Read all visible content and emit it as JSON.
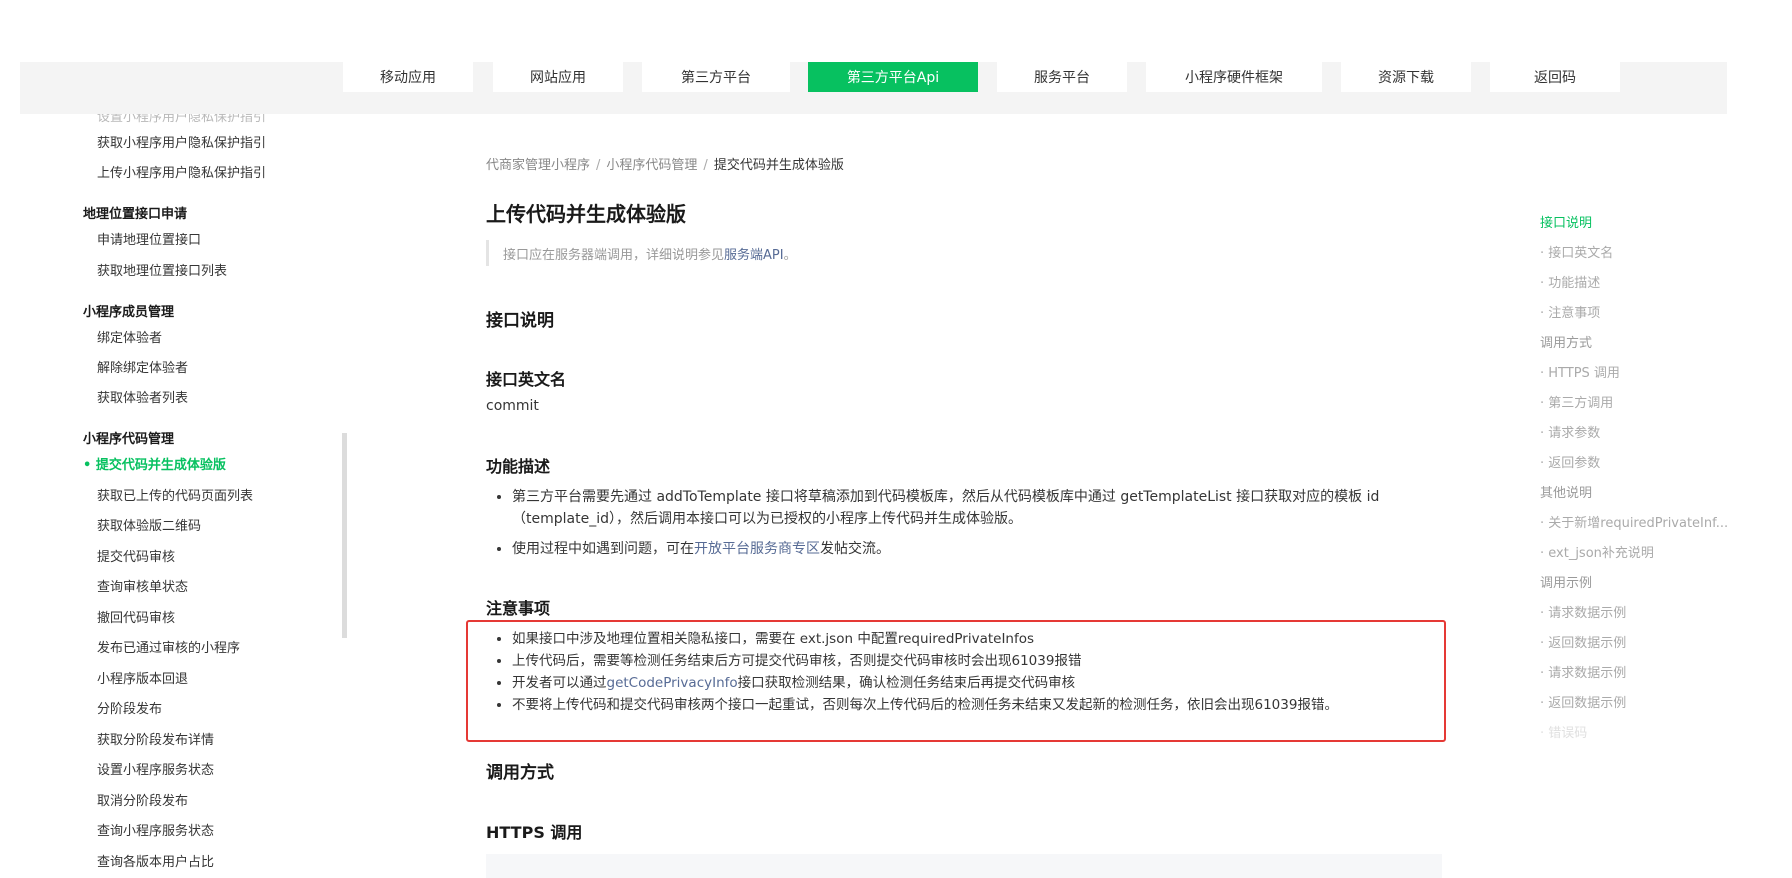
{
  "nav": {
    "tabs": [
      {
        "label": "移动应用"
      },
      {
        "label": "网站应用"
      },
      {
        "label": "第三方平台"
      },
      {
        "label": "第三方平台Api"
      },
      {
        "label": "服务平台"
      },
      {
        "label": "小程序硬件框架"
      },
      {
        "label": "资源下载"
      },
      {
        "label": "返回码"
      }
    ],
    "active_index": 3
  },
  "sidebar": {
    "clipped_top": "设置小程序用户隐私保护指引",
    "items": [
      {
        "label": "获取小程序用户隐私保护指引"
      },
      {
        "label": "上传小程序用户隐私保护指引"
      },
      {
        "group": "地理位置接口申请"
      },
      {
        "label": "申请地理位置接口"
      },
      {
        "label": "获取地理位置接口列表"
      },
      {
        "group": "小程序成员管理"
      },
      {
        "label": "绑定体验者"
      },
      {
        "label": "解除绑定体验者"
      },
      {
        "label": "获取体验者列表"
      },
      {
        "group": "小程序代码管理"
      },
      {
        "label": "提交代码并生成体验版",
        "active": true
      },
      {
        "label": "获取已上传的代码页面列表"
      },
      {
        "label": "获取体验版二维码"
      },
      {
        "label": "提交代码审核"
      },
      {
        "label": "查询审核单状态"
      },
      {
        "label": "撤回代码审核"
      },
      {
        "label": "发布已通过审核的小程序"
      },
      {
        "label": "小程序版本回退"
      },
      {
        "label": "分阶段发布"
      },
      {
        "label": "获取分阶段发布详情"
      },
      {
        "label": "设置小程序服务状态"
      },
      {
        "label": "取消分阶段发布"
      },
      {
        "label": "查询小程序服务状态"
      },
      {
        "label": "查询各版本用户占比"
      }
    ]
  },
  "breadcrumb": {
    "items": [
      "代商家管理小程序",
      "小程序代码管理",
      "提交代码并生成体验版"
    ],
    "separator": "/"
  },
  "page": {
    "title": "上传代码并生成体验版",
    "notice_prefix": "接口应在服务器端调用，详细说明参见",
    "notice_link": "服务端API",
    "notice_suffix": "。"
  },
  "content": {
    "section_interface": "接口说明",
    "english_name_heading": "接口英文名",
    "english_name": "commit",
    "func_heading": "功能描述",
    "func_item1": "第三方平台需要先通过 addToTemplate 接口将草稿添加到代码模板库，然后从代码模板库中通过 getTemplateList 接口获取对应的模板 id（template_id），然后调用本接口可以为已授权的小程序上传代码并生成体验版。",
    "func_item2_prefix": "使用过程中如遇到问题，可在",
    "func_item2_link": "开放平台服务商专区",
    "func_item2_suffix": "发帖交流。",
    "notes_heading": "注意事项",
    "note1": "如果接口中涉及地理位置相关隐私接口，需要在 ext.json 中配置requiredPrivateInfos",
    "note2": "上传代码后，需要等检测任务结束后方可提交代码审核，否则提交代码审核时会出现61039报错",
    "note3_prefix": "开发者可以通过",
    "note3_link": "getCodePrivacyInfo",
    "note3_suffix": "接口获取检测结果，确认检测任务结束后再提交代码审核",
    "note4": "不要将上传代码和提交代码审核两个接口一起重试，否则每次上传代码后的检测任务未结束又发起新的检测任务，依旧会出现61039报错。",
    "call_heading": "调用方式",
    "https_heading": "HTTPS 调用"
  },
  "toc": {
    "items": [
      {
        "label": "接口说明",
        "active": true
      },
      {
        "label": "· 接口英文名"
      },
      {
        "label": "· 功能描述"
      },
      {
        "label": "· 注意事项"
      },
      {
        "label": "调用方式"
      },
      {
        "label": "· HTTPS 调用"
      },
      {
        "label": "· 第三方调用"
      },
      {
        "label": "· 请求参数"
      },
      {
        "label": "· 返回参数"
      },
      {
        "label": "其他说明"
      },
      {
        "label": "· 关于新增requiredPrivateInf..."
      },
      {
        "label": "· ext_json补充说明"
      },
      {
        "label": "调用示例"
      },
      {
        "label": "· 请求数据示例"
      },
      {
        "label": "· 返回数据示例"
      },
      {
        "label": "· 请求数据示例"
      },
      {
        "label": "· 返回数据示例"
      },
      {
        "label": "· 错误码"
      }
    ]
  },
  "colors": {
    "accent": "#07c160",
    "link": "#576b95",
    "highlight_box": "#e53935"
  }
}
